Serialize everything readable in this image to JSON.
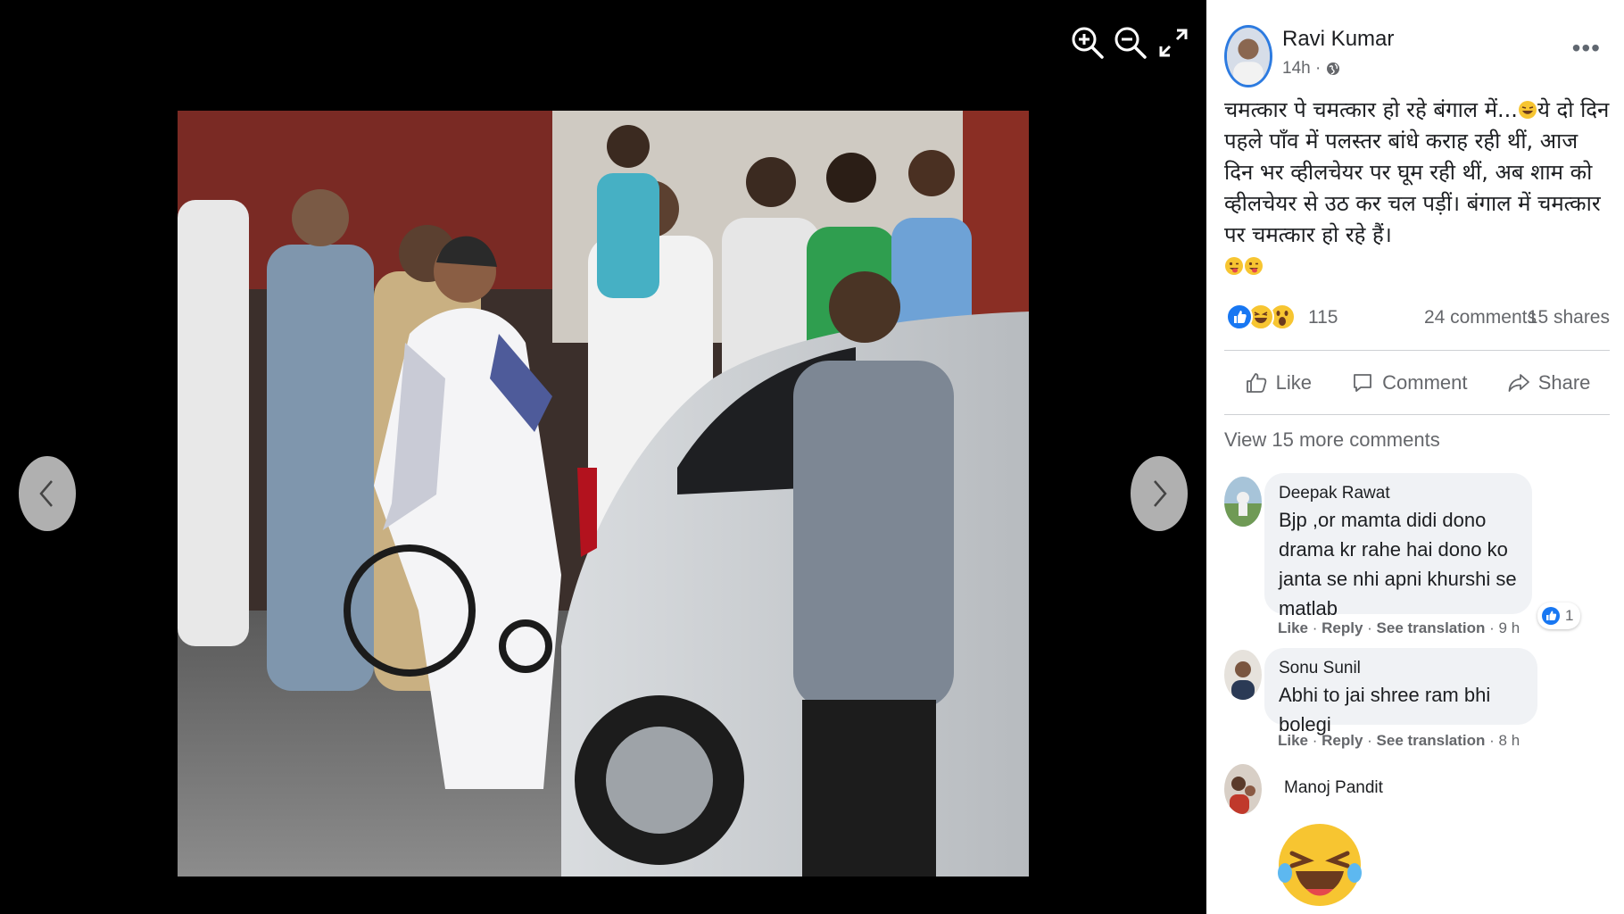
{
  "viewer": {
    "zoom_in_icon": "zoom-in-icon",
    "zoom_out_icon": "zoom-out-icon",
    "fullscreen_icon": "expand-icon",
    "prev_icon": "chevron-left-icon",
    "next_icon": "chevron-right-icon"
  },
  "post": {
    "author": "Ravi Kumar",
    "time": "14h ·",
    "text_line1": "चमत्कार पे चमत्कार हो रहे बंगाल में...",
    "text_line1_b": "ये दो दिन पहले पाँव में पलस्तर बांधे कराह रही थीं, आज दिन भर व्हीलचेयर पर घूम रही थीं, अब शाम को व्हीलचेयर से उठ कर चल पड़ीं। बंगाल में चमत्कार पर चमत्कार हो रहे हैं।",
    "emoji_tail": "😜😜",
    "reaction_count": "115",
    "comments_count": "24 comments",
    "shares_count": "15 shares",
    "actions": {
      "like": "Like",
      "comment": "Comment",
      "share": "Share"
    },
    "view_more": "View 15 more comments"
  },
  "comments": [
    {
      "name": "Deepak Rawat",
      "text": "Bjp ,or mamta didi dono drama kr rahe hai dono ko janta se nhi apni khurshi se matlab",
      "like": "Like",
      "reply": "Reply",
      "translate": "See translation",
      "time": "· 9 h",
      "likes": "1"
    },
    {
      "name": "Sonu Sunil",
      "text": "Abhi to jai shree ram bhi bolegi",
      "like": "Like",
      "reply": "Reply",
      "translate": "See translation",
      "time": "· 8 h"
    },
    {
      "name": "Manoj Pandit"
    }
  ],
  "colors": {
    "facebook_blue": "#1877f2",
    "reaction_yellow": "#f7c531",
    "panel_text": "#1c1e21",
    "secondary_text": "#65676b"
  }
}
